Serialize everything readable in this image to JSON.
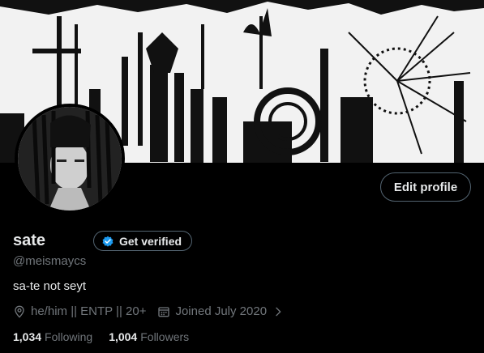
{
  "profile": {
    "name": "sate",
    "handle": "@meismaycs",
    "bio": "sa-te not seyt",
    "location": "he/him || ENTP || 20+",
    "joined": "Joined July 2020"
  },
  "buttons": {
    "edit_profile": "Edit profile",
    "get_verified": "Get verified"
  },
  "stats": {
    "following_count": "1,034",
    "following_label": "Following",
    "followers_count": "1,004",
    "followers_label": "Followers"
  },
  "colors": {
    "background": "#000000",
    "text": "#e7e9ea",
    "muted": "#71767b",
    "border": "#536471",
    "verified": "#1d9bf0"
  },
  "icons": [
    "location-icon",
    "calendar-icon",
    "chevron-right-icon",
    "verified-badge-icon"
  ]
}
